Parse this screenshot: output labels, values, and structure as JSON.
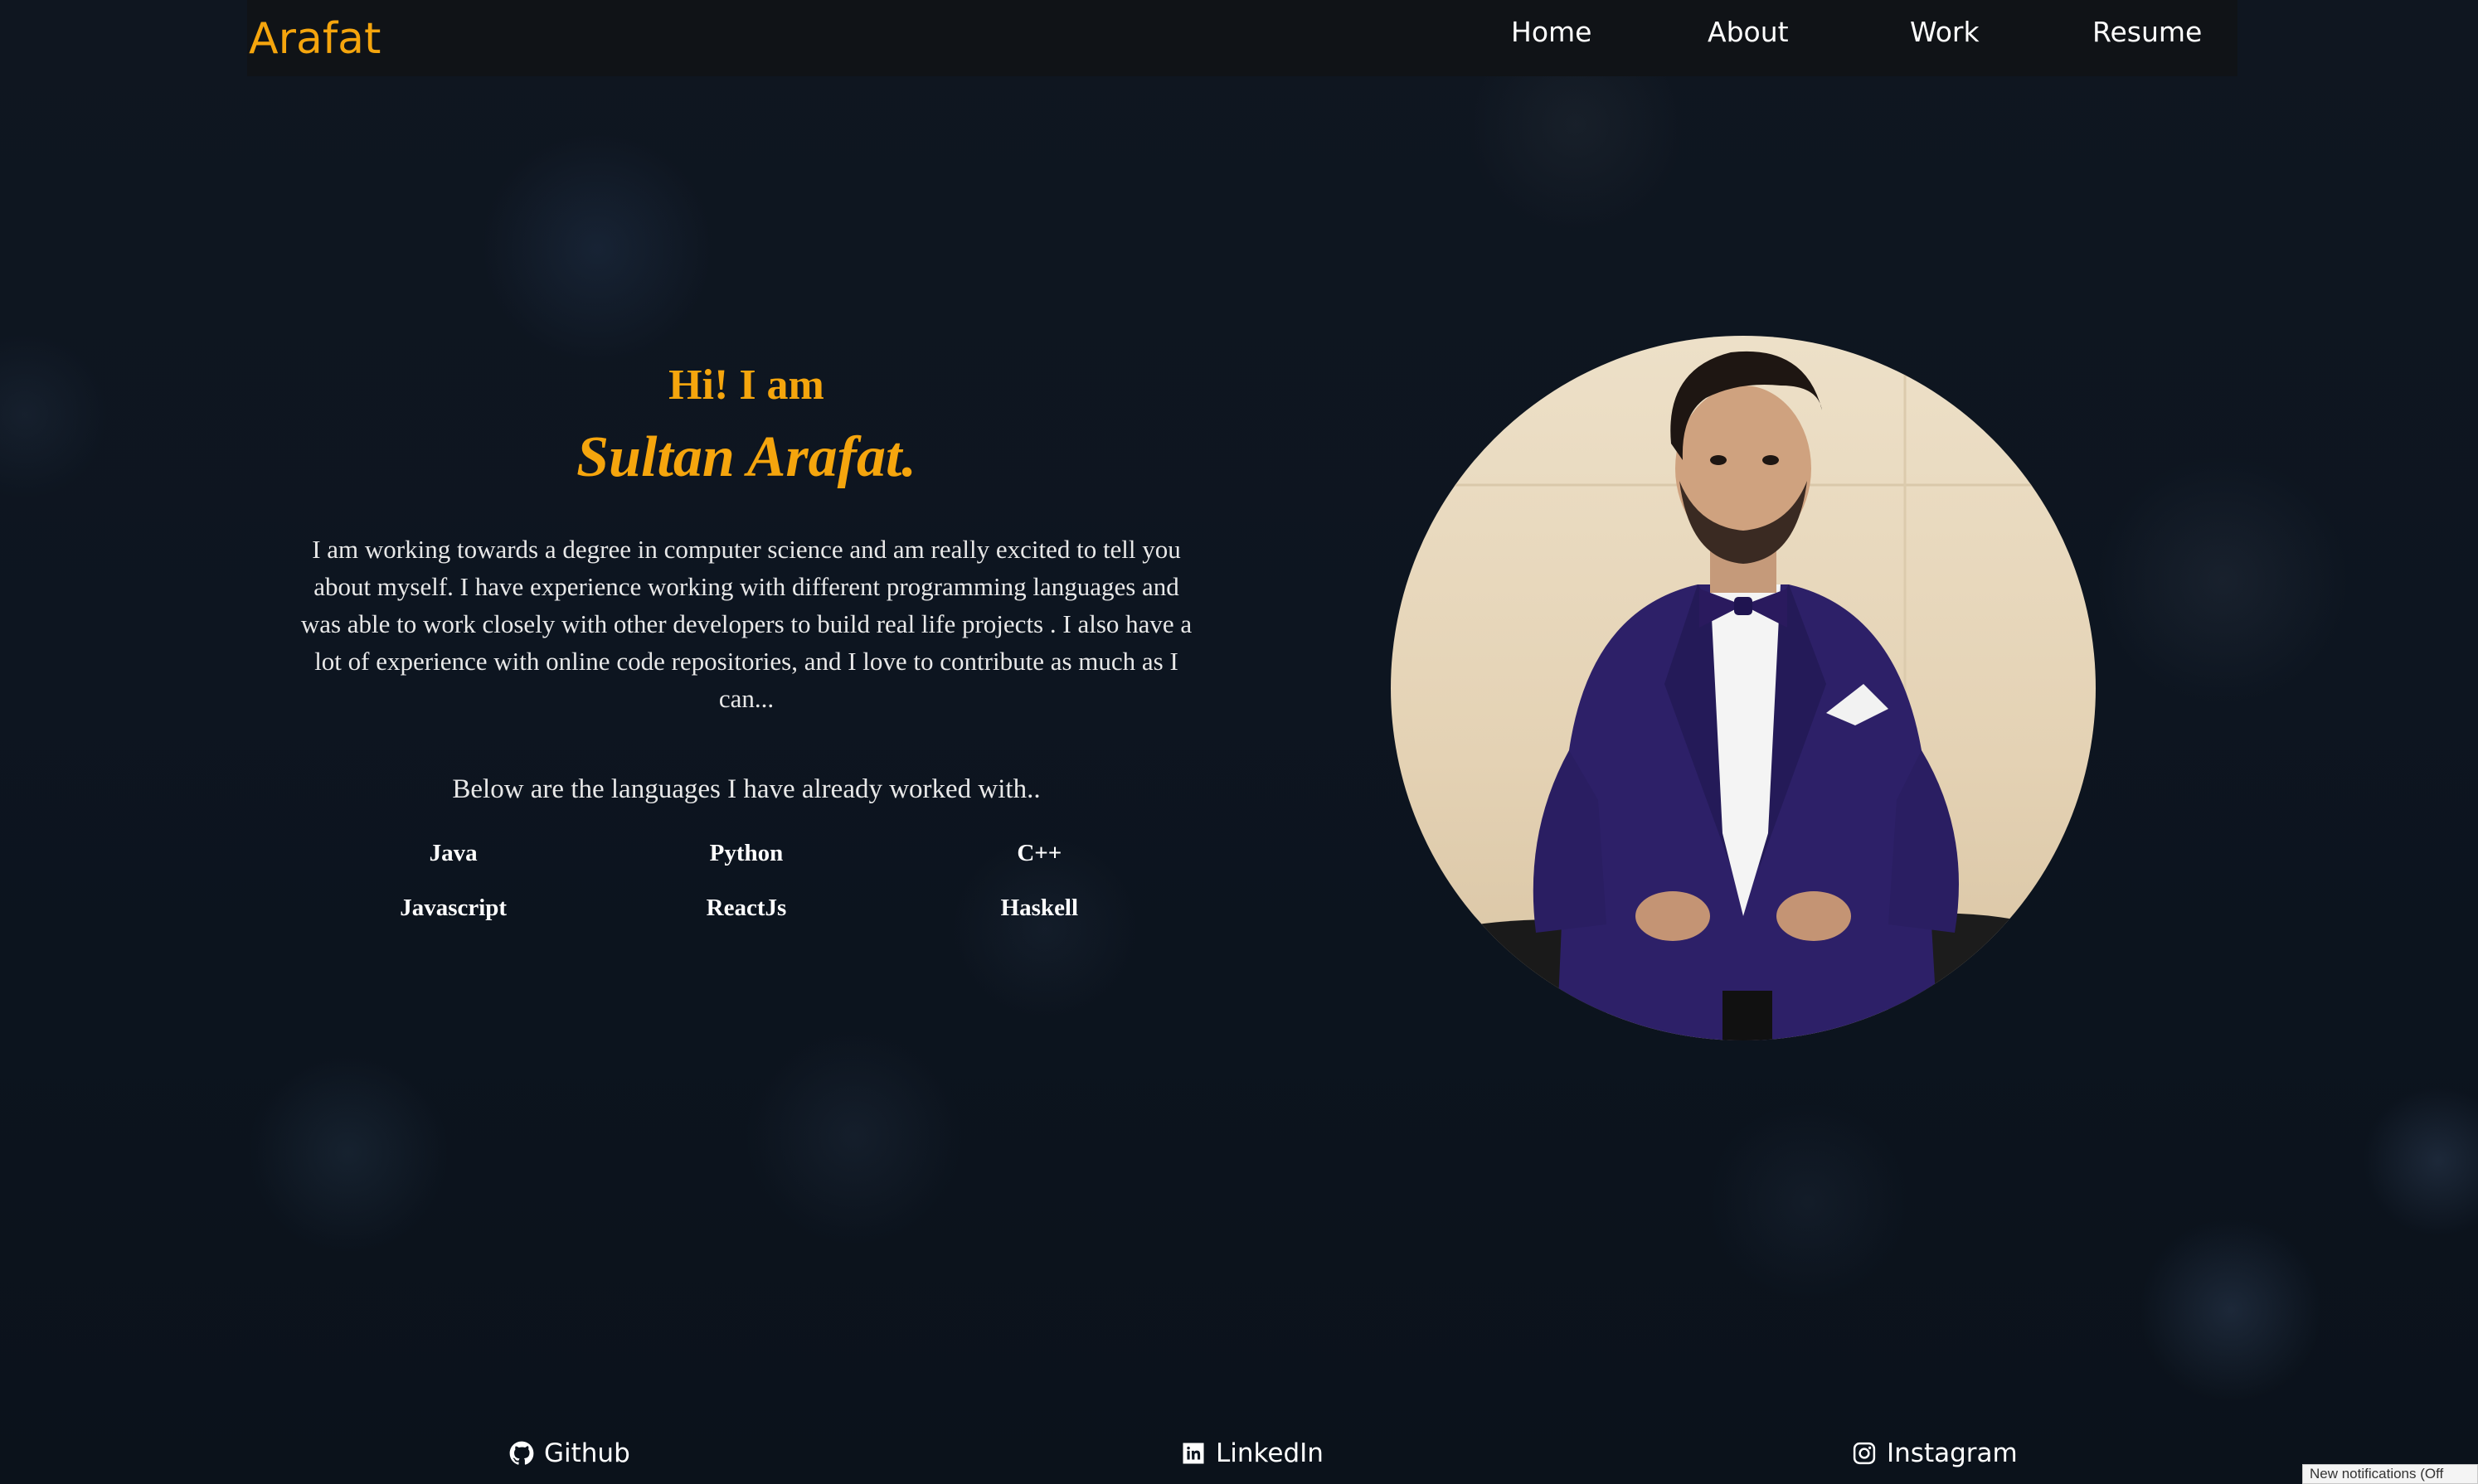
{
  "nav": {
    "brand": "Arafat",
    "links": [
      "Home",
      "About",
      "Work",
      "Resume"
    ]
  },
  "intro": {
    "greeting": "Hi! I am",
    "name": "Sultan Arafat.",
    "bio": "I am working towards a degree in computer science and am really excited to tell you about myself. I have experience working with different programming languages and was able to work closely with other developers to build real life projects . I also have a lot of experience with online code repositories, and I love to contribute as much as I can...",
    "languages_intro": "Below are the languages I have already worked with..",
    "languages": [
      "Java",
      "Python",
      "C++",
      "Javascript",
      "ReactJs",
      "Haskell"
    ]
  },
  "social": {
    "github": "Github",
    "linkedin": "LinkedIn",
    "instagram": "Instagram"
  },
  "notification": "New notifications (Off",
  "colors": {
    "accent": "#f5a50d",
    "background": "#0d1520",
    "navbar": "#101317"
  }
}
